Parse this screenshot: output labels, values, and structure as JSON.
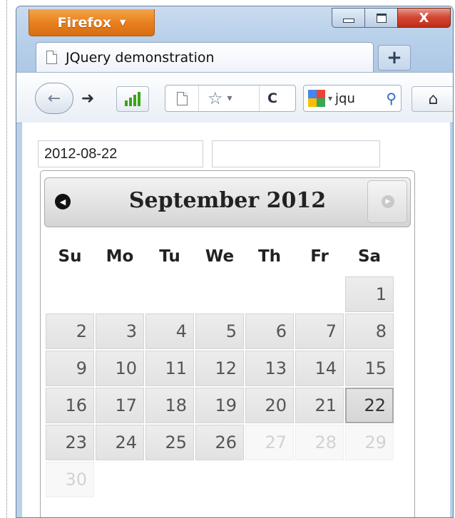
{
  "browser": {
    "app_button_label": "Firefox",
    "app_button_arrow": "▼",
    "window_controls": [
      "minimize-icon",
      "maximize-icon",
      "close-icon"
    ],
    "close_glyph": "X",
    "tab_title": "JQuery demonstration",
    "new_tab_label": "+",
    "nav": {
      "back_glyph": "←",
      "forward_glyph": "➜",
      "reload_glyph": "C",
      "star_glyph": "☆",
      "dropdown_glyph": "▾",
      "search_text": "jqu",
      "search_glyph": "⚲",
      "home_glyph": "⌂"
    }
  },
  "form": {
    "date_value": "2012-08-22",
    "second_value": ""
  },
  "datepicker": {
    "title": "September 2012",
    "prev_glyph": "◀",
    "next_glyph": "▶",
    "weekdays": [
      "Su",
      "Mo",
      "Tu",
      "We",
      "Th",
      "Fr",
      "Sa"
    ],
    "weeks": [
      [
        null,
        null,
        null,
        null,
        null,
        null,
        {
          "d": "1"
        }
      ],
      [
        {
          "d": "2"
        },
        {
          "d": "3"
        },
        {
          "d": "4"
        },
        {
          "d": "5"
        },
        {
          "d": "6"
        },
        {
          "d": "7"
        },
        {
          "d": "8"
        }
      ],
      [
        {
          "d": "9"
        },
        {
          "d": "10"
        },
        {
          "d": "11"
        },
        {
          "d": "12"
        },
        {
          "d": "13"
        },
        {
          "d": "14"
        },
        {
          "d": "15"
        }
      ],
      [
        {
          "d": "16"
        },
        {
          "d": "17"
        },
        {
          "d": "18"
        },
        {
          "d": "19"
        },
        {
          "d": "20"
        },
        {
          "d": "21"
        },
        {
          "d": "22",
          "state": "selected"
        }
      ],
      [
        {
          "d": "23"
        },
        {
          "d": "24"
        },
        {
          "d": "25"
        },
        {
          "d": "26"
        },
        {
          "d": "27",
          "state": "disabled"
        },
        {
          "d": "28",
          "state": "disabled"
        },
        {
          "d": "29",
          "state": "disabled"
        }
      ],
      [
        {
          "d": "30",
          "state": "disabled"
        },
        null,
        null,
        null,
        null,
        null,
        null
      ]
    ]
  }
}
